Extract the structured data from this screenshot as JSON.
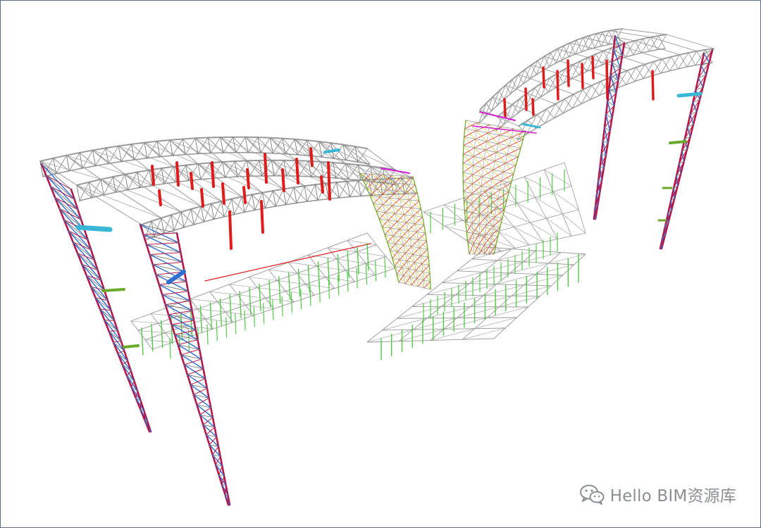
{
  "watermark": {
    "text": "Hello BIM资源库",
    "icon": "wechat-icon"
  },
  "colors": {
    "frame_border": "#5a6f86",
    "truss_gray": "#9a9a9a",
    "truss_dark": "#6b6b6b",
    "hanger_red": "#e01b1b",
    "column_crimson": "#b5174a",
    "brace_blue": "#2f6fd0",
    "floor_green": "#52c84a",
    "accent_cyan": "#3ab6d6",
    "accent_magenta": "#d21bd2",
    "accent_yellow": "#e8d23a",
    "accent_olive": "#6aaa2a",
    "watermark_gray": "#8a8f94"
  }
}
